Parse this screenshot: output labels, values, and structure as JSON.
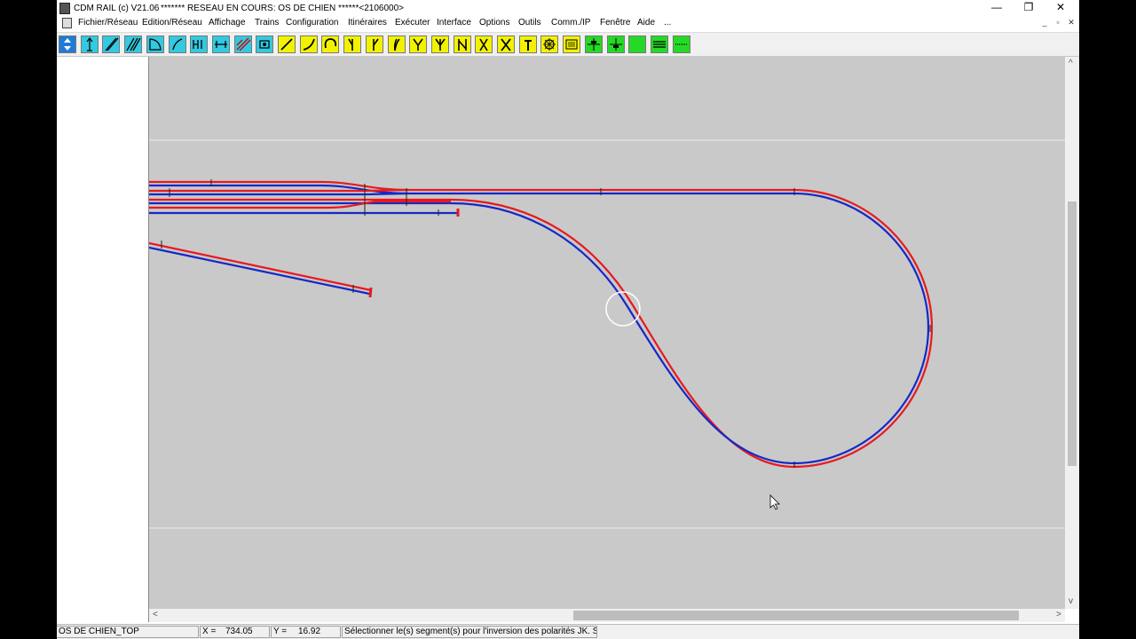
{
  "window": {
    "app_title": "CDM RAIL (c) V21.06",
    "network_title": "******* RESEAU EN COURS: OS DE CHIEN ******<2106000>",
    "minimize": "—",
    "restore": "❐",
    "close": "✕"
  },
  "menu": {
    "items": [
      "Fichier/Réseau",
      "Edition/Réseau",
      "Affichage",
      "Trains",
      "Configuration",
      "Itinéraires",
      "Exécuter",
      "Interface",
      "Options",
      "Outils",
      "Comm./IP",
      "Fenêtre",
      "Aide",
      "..."
    ],
    "mdi_minimize": "_",
    "mdi_restore": "▫",
    "mdi_close": "✕"
  },
  "toolbar": {
    "buttons": [
      {
        "icon": "move-arrows-icon",
        "color": "#1f7bd6"
      },
      {
        "icon": "up-arrow-track-icon",
        "color": "#33c9e0"
      },
      {
        "icon": "diagonal-track-icon",
        "color": "#33c9e0"
      },
      {
        "icon": "double-diagonal-icon",
        "color": "#33c9e0"
      },
      {
        "icon": "curve-corner-icon",
        "color": "#33c9e0"
      },
      {
        "icon": "small-curve-icon",
        "color": "#33c9e0"
      },
      {
        "icon": "hi-signal-icon",
        "color": "#33c9e0"
      },
      {
        "icon": "horizontal-block-icon",
        "color": "#33c9e0"
      },
      {
        "icon": "polarity-invert-icon",
        "color": "#33c9e0"
      },
      {
        "icon": "loco-icon",
        "color": "#33c9e0"
      },
      {
        "icon": "straight-segment-icon",
        "color": "#f2f200"
      },
      {
        "icon": "curve-segment-icon",
        "color": "#f2f200"
      },
      {
        "icon": "loop-segment-icon",
        "color": "#f2f200"
      },
      {
        "icon": "turnout-left-icon",
        "color": "#f2f200"
      },
      {
        "icon": "turnout-right-icon",
        "color": "#f2f200"
      },
      {
        "icon": "curved-turnout-icon",
        "color": "#f2f200"
      },
      {
        "icon": "y-turnout-icon",
        "color": "#f2f200"
      },
      {
        "icon": "three-way-turnout-icon",
        "color": "#f2f200"
      },
      {
        "icon": "double-slip-icon",
        "color": "#f2f200"
      },
      {
        "icon": "single-slip-icon",
        "color": "#f2f200"
      },
      {
        "icon": "crossing-icon",
        "color": "#f2f200"
      },
      {
        "icon": "buffer-stop-icon",
        "color": "#f2f200"
      },
      {
        "icon": "turntable-icon",
        "color": "#f2f200"
      },
      {
        "icon": "text-block-icon",
        "color": "#f2f200"
      },
      {
        "icon": "signal-green-icon",
        "color": "#26d926"
      },
      {
        "icon": "signal-green-2-icon",
        "color": "#26d926"
      },
      {
        "icon": "plain-green-icon",
        "color": "#26d926"
      },
      {
        "icon": "stripes-green-icon",
        "color": "#26d926"
      },
      {
        "icon": "dotted-green-icon",
        "color": "#26d926"
      }
    ]
  },
  "colors": {
    "rail_positive": "#e8191e",
    "rail_negative": "#1428c8",
    "canvas_bg": "#c9c9c9"
  },
  "status": {
    "network_name": "OS DE CHIEN_TOP",
    "x_label": "X =",
    "x_value": "734.05",
    "y_label": "Y =",
    "y_value": "16.92",
    "message": "Sélectionner le(s) segment(s) pour l'inversion des polarités JK. Sel. m"
  },
  "scroll": {
    "left": "<",
    "right": ">",
    "up": "^",
    "down": "v"
  }
}
